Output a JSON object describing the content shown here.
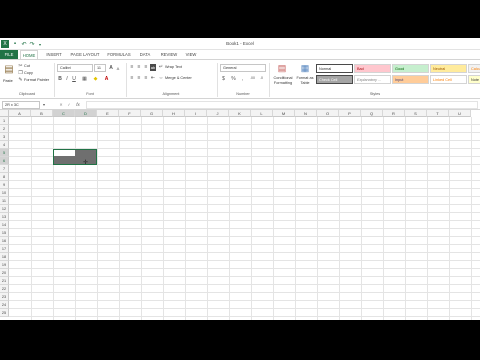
{
  "title_bar": {
    "title": "Book1 - Excel"
  },
  "tabs": [
    "FILE",
    "HOME",
    "INSERT",
    "PAGE LAYOUT",
    "FORMULAS",
    "DATA",
    "REVIEW",
    "VIEW"
  ],
  "clipboard": {
    "paste": "Paste",
    "cut": "Cut",
    "copy": "Copy",
    "format_painter": "Format Painter",
    "group": "Clipboard"
  },
  "font": {
    "name": "Calibri",
    "size": "11",
    "bold": "B",
    "italic": "I",
    "underline": "U",
    "grow": "A",
    "shrink": "A",
    "group": "Font"
  },
  "alignment": {
    "wrap_text": "Wrap Text",
    "merge_center": "Merge & Center",
    "group": "Alignment"
  },
  "number": {
    "format": "General",
    "currency": "$",
    "percent": "%",
    "comma": ",",
    "group": "Number"
  },
  "styles_group": {
    "conditional": "Conditional Formatting",
    "format_table": "Format as Table",
    "group": "Styles"
  },
  "cell_styles": [
    {
      "label": "Normal",
      "bg": "#ffffff",
      "fg": "#333333"
    },
    {
      "label": "Bad",
      "bg": "#ffc7ce",
      "fg": "#9c0006"
    },
    {
      "label": "Good",
      "bg": "#c6efce",
      "fg": "#006100"
    },
    {
      "label": "Neutral",
      "bg": "#ffeb9c",
      "fg": "#9c5700"
    },
    {
      "label": "Calcul",
      "bg": "#f2f2f2",
      "fg": "#fa7d00"
    },
    {
      "label": "Check Cell",
      "bg": "#a5a5a5",
      "fg": "#ffffff"
    },
    {
      "label": "Explanatory ...",
      "bg": "#ffffff",
      "fg": "#7f7f7f"
    },
    {
      "label": "Input",
      "bg": "#ffcc99",
      "fg": "#3f3f76"
    },
    {
      "label": "Linked Cell",
      "bg": "#ffffff",
      "fg": "#fa7d00"
    },
    {
      "label": "Note",
      "bg": "#ffffcc",
      "fg": "#333333"
    }
  ],
  "formula_bar": {
    "name_box": "2R x 3C",
    "cancel": "✕",
    "enter": "✓",
    "fx": "fx",
    "content": ""
  },
  "columns": [
    "A",
    "B",
    "C",
    "D",
    "E",
    "F",
    "G",
    "H",
    "I",
    "J",
    "K",
    "L",
    "M",
    "N",
    "O",
    "P",
    "Q",
    "R",
    "S",
    "T",
    "U"
  ],
  "rows": [
    "1",
    "2",
    "3",
    "4",
    "5",
    "6",
    "7",
    "8",
    "9",
    "10",
    "11",
    "12",
    "13",
    "14",
    "15",
    "16",
    "17",
    "18",
    "19",
    "20",
    "21",
    "22",
    "23",
    "24",
    "25"
  ],
  "accent": "#217346"
}
